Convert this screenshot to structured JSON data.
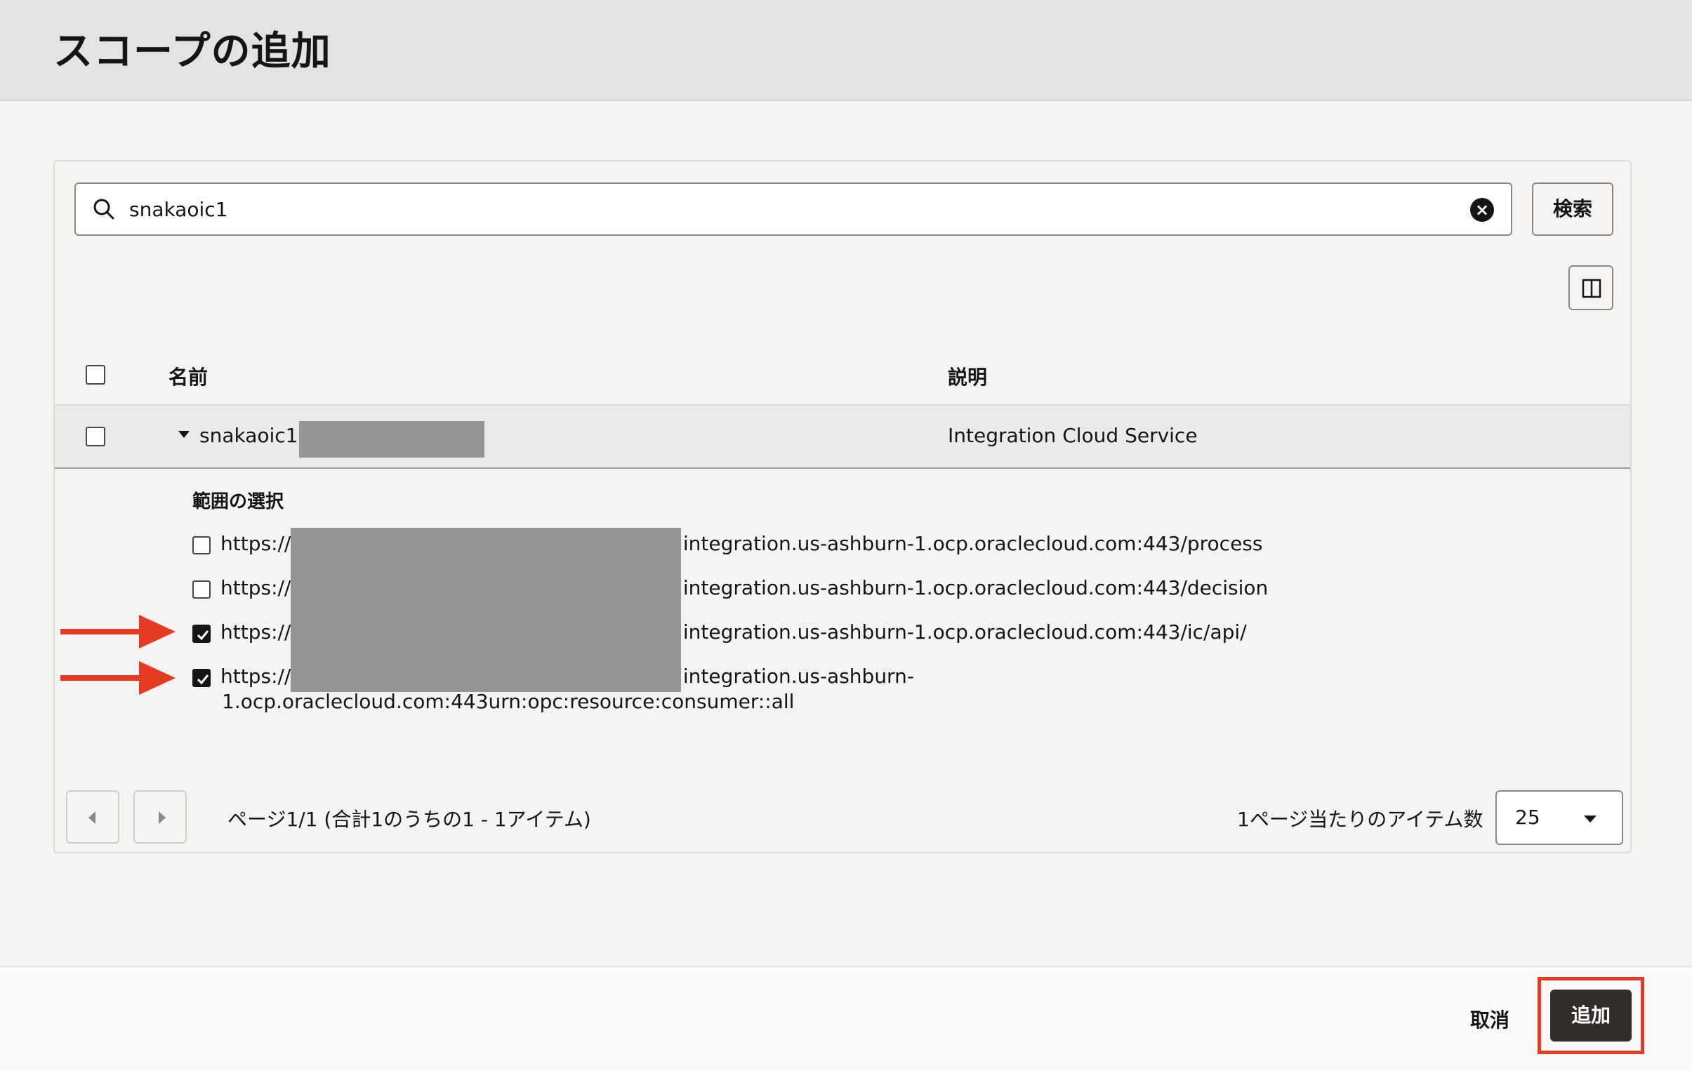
{
  "header": {
    "title": "スコープの追加"
  },
  "search": {
    "value": "snakaoic1",
    "button_label": "検索"
  },
  "table": {
    "columns": {
      "name": "名前",
      "description": "説明"
    },
    "rows": [
      {
        "name": "snakaoic1-",
        "description": "Integration Cloud Service",
        "expanded": true
      }
    ]
  },
  "scope_selection": {
    "title": "範囲の選択",
    "items": [
      {
        "prefix": "https://",
        "suffix": ".integration.us-ashburn-1.ocp.oraclecloud.com:443/process",
        "line2": "",
        "checked": false
      },
      {
        "prefix": "https://",
        "suffix": ".integration.us-ashburn-1.ocp.oraclecloud.com:443/decision",
        "line2": "",
        "checked": false
      },
      {
        "prefix": "https://",
        "suffix": ".integration.us-ashburn-1.ocp.oraclecloud.com:443/ic/api/",
        "line2": "",
        "checked": true
      },
      {
        "prefix": "https://",
        "suffix": ".integration.us-ashburn-",
        "line2": "1.ocp.oraclecloud.com:443urn:opc:resource:consumer::all",
        "checked": true
      }
    ]
  },
  "pagination": {
    "status": "ページ1/1 (合計1のうちの1 - 1アイテム)",
    "per_page_label": "1ページ当たりのアイテム数",
    "per_page_value": "25"
  },
  "footer": {
    "cancel_label": "取消",
    "add_label": "追加"
  },
  "colors": {
    "accent_red": "#e43c24",
    "primary_button": "#312d2a",
    "redaction": "#949494"
  }
}
